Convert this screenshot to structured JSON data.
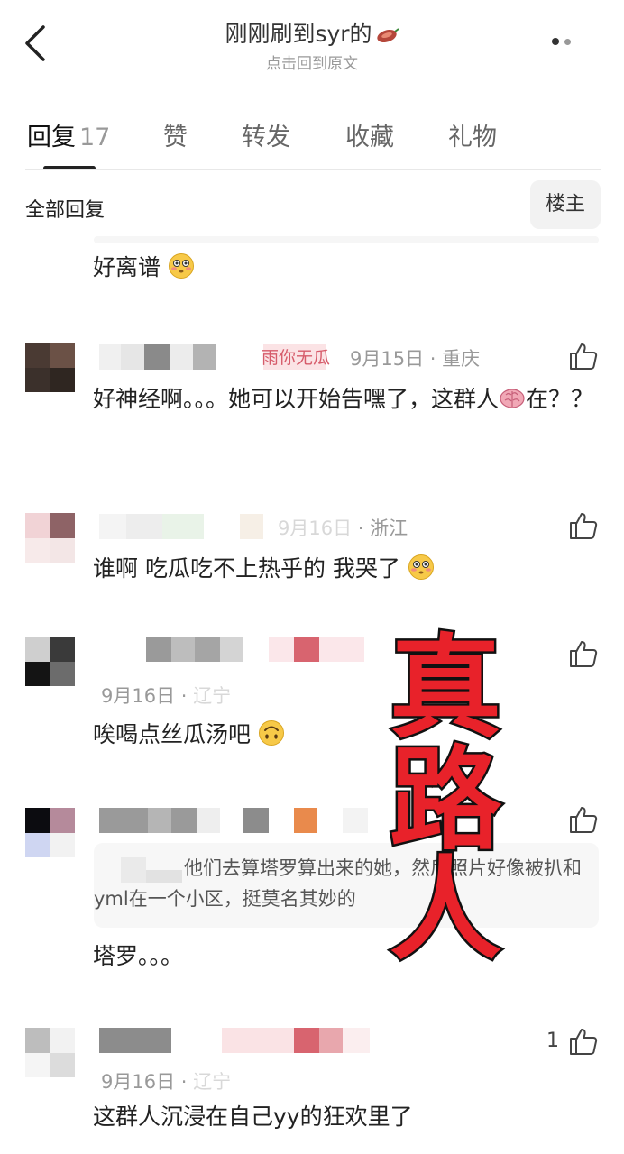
{
  "header": {
    "title": "刚刚刷到syr的",
    "subtitle": "点击回到原文",
    "icons": {
      "back": "chevron-left-icon",
      "more": "more-dots-icon",
      "title_emoji": "sweet-potato-emoji"
    }
  },
  "tabs": [
    {
      "label": "回复",
      "count": "17"
    },
    {
      "label": "赞"
    },
    {
      "label": "转发"
    },
    {
      "label": "收藏"
    },
    {
      "label": "礼物"
    }
  ],
  "filter": {
    "label": "全部回复",
    "owner_button": "楼主"
  },
  "comments": [
    {
      "text": "好离谱",
      "emoji": "flushed-face"
    },
    {
      "name_suffix": "雨你无瓜",
      "date": "9月15日",
      "location": "重庆",
      "text": "好神经啊。。。她可以开始告嘿了，这群人",
      "text_after_emoji": "在？？",
      "emoji": "brain"
    },
    {
      "date": "9月16日",
      "location": "浙江",
      "text": "谁啊 吃瓜吃不上热乎的 我哭了",
      "emoji": "flushed-face"
    },
    {
      "date": "9月16日",
      "location": "辽宁",
      "text": "唉喝点丝瓜汤吧",
      "emoji": "upside-down-face"
    },
    {
      "quote": "他们去算塔罗算出来的她，然后照片好像被扒和yml在一个小区，挺莫名其妙的",
      "text": "塔罗。。。"
    },
    {
      "date": "9月16日",
      "location": "辽宁",
      "likes": "1",
      "text": "这群人沉浸在自己yy的狂欢里了"
    }
  ],
  "overlay": {
    "line1": "真",
    "line2": "路",
    "line3": "人"
  },
  "colors": {
    "accent": "#e8222a",
    "muted": "#999999",
    "text": "#222222"
  }
}
